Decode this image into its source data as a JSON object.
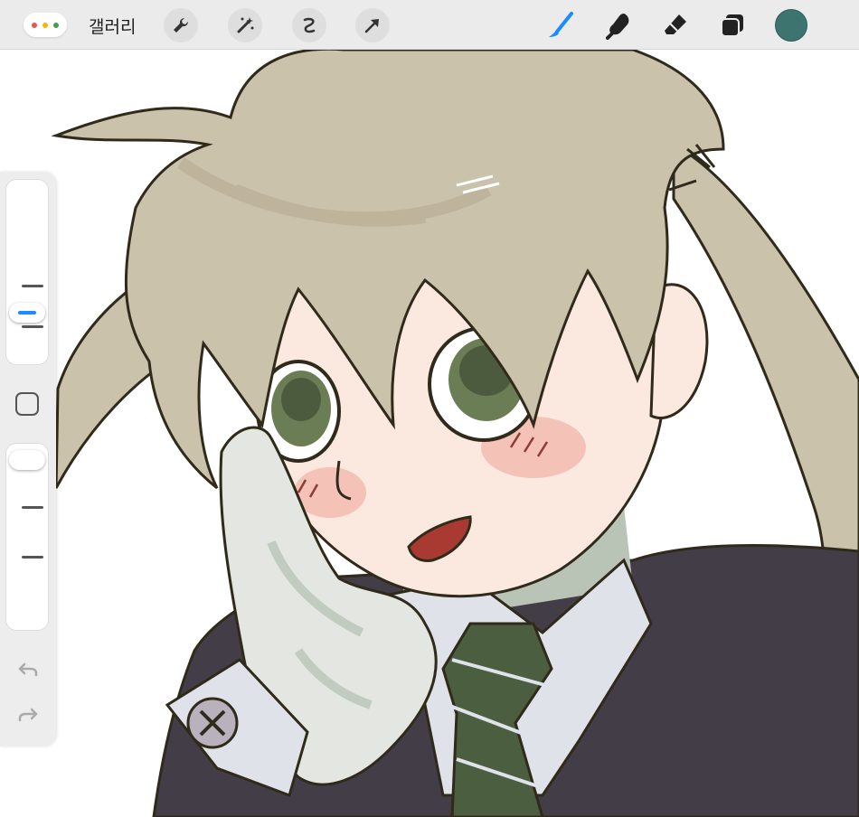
{
  "toolbar": {
    "gallery_label": "갤러리",
    "window_dots": [
      "#ef5350",
      "#ffb300",
      "#43a047"
    ],
    "left_tools": [
      "wrench-icon",
      "magic-wand-icon",
      "selection-icon",
      "transform-arrow-icon"
    ],
    "right_tools": [
      "brush-icon",
      "smudge-icon",
      "eraser-icon",
      "layers-icon"
    ],
    "active_tool": "brush-icon",
    "accent": "#1a8cff",
    "current_color": "#3d7470"
  },
  "sidebar": {
    "brush_size_level": 0.15,
    "opacity_level": 0.8,
    "modifier_icon": "square-icon",
    "undo_icon": "undo-arrow-icon",
    "redo_icon": "redo-arrow-icon"
  },
  "canvas": {
    "colors": {
      "hair": "#cbc2ac",
      "hair_shadow": "#b8ae96",
      "line": "#2f2a1a",
      "skin": "#fbe9df",
      "blush": "#f3b8ab",
      "eye": "#6b7d54",
      "eye_dark": "#3f4d33",
      "glove": "#e4e6e1",
      "glove_shadow": "#b9c4b6",
      "shirt": "#dfe2e9",
      "coat": "#433d47",
      "tie": "#4b5e3f",
      "mouth": "#a83a32",
      "badge": "#b9b1bc"
    }
  }
}
